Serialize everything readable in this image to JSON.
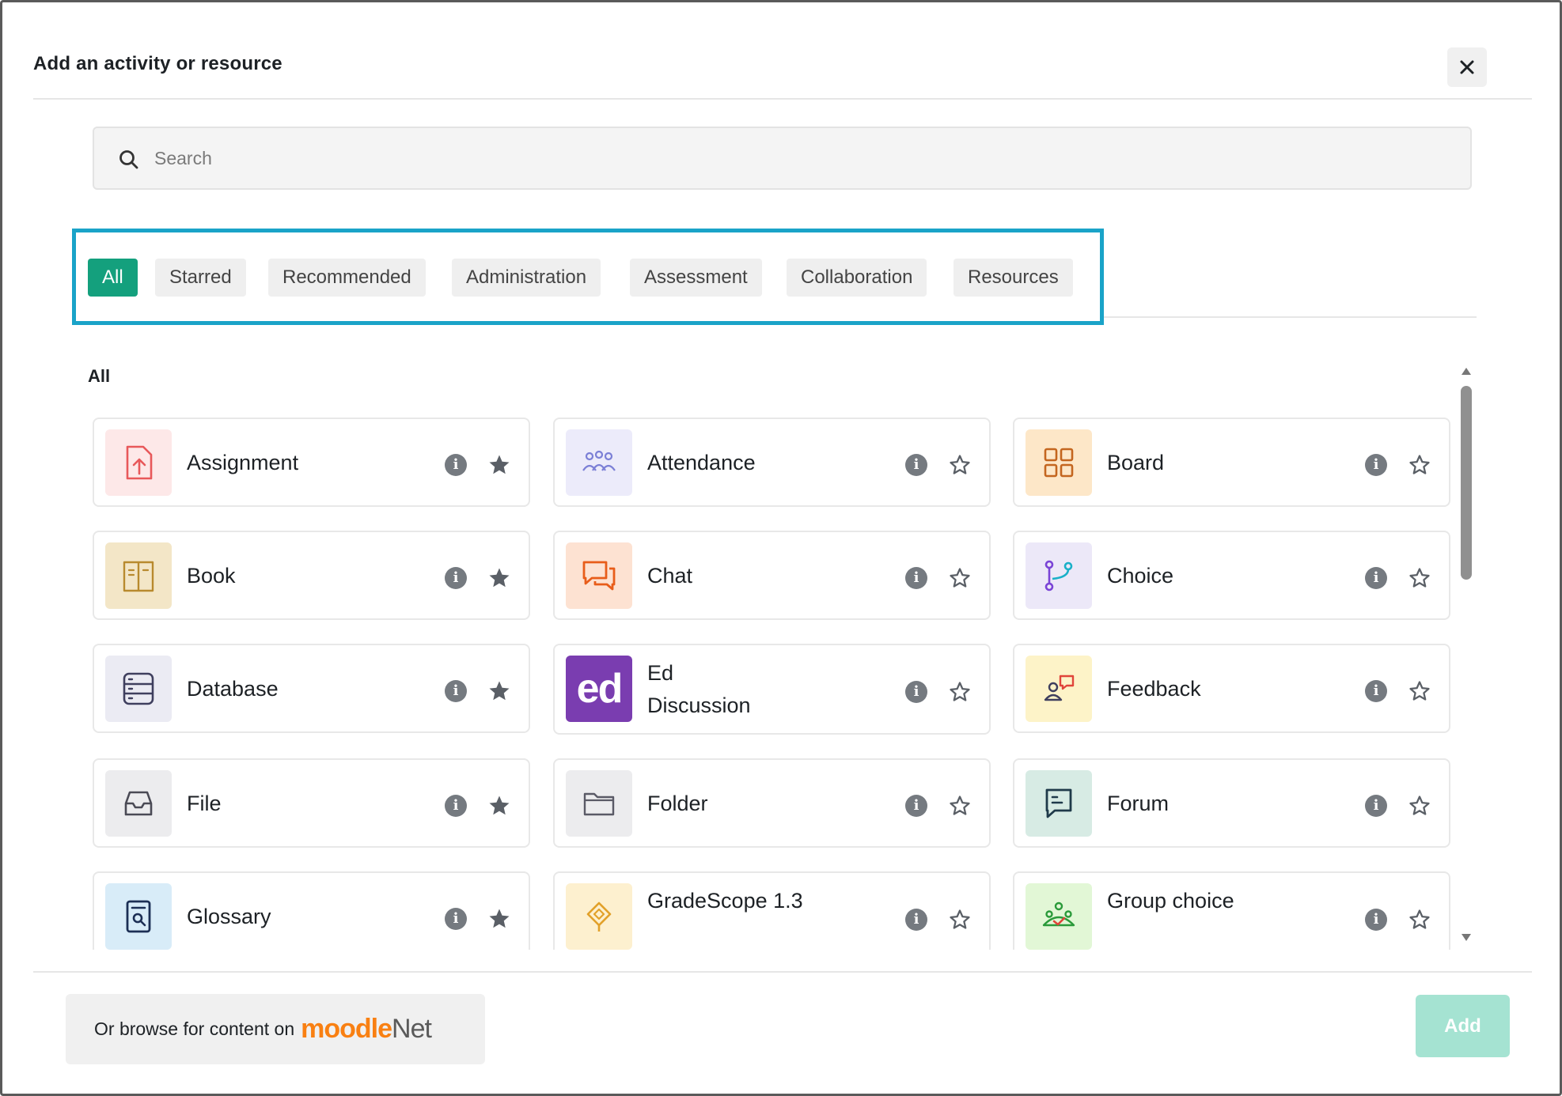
{
  "modal": {
    "title": "Add an activity or resource"
  },
  "search": {
    "placeholder": "Search"
  },
  "tabs": [
    {
      "label": "All",
      "active": true
    },
    {
      "label": "Starred",
      "active": false
    },
    {
      "label": "Recommended",
      "active": false
    },
    {
      "label": "Administration",
      "active": false
    },
    {
      "label": "Assessment",
      "active": false
    },
    {
      "label": "Collaboration",
      "active": false
    },
    {
      "label": "Resources",
      "active": false
    }
  ],
  "section": {
    "heading": "All"
  },
  "activities": [
    {
      "name": "Assignment",
      "icon": "assignment-icon",
      "starred": true
    },
    {
      "name": "Attendance",
      "icon": "attendance-icon",
      "starred": false
    },
    {
      "name": "Board",
      "icon": "board-icon",
      "starred": false
    },
    {
      "name": "Book",
      "icon": "book-icon",
      "starred": true
    },
    {
      "name": "Chat",
      "icon": "chat-icon",
      "starred": false
    },
    {
      "name": "Choice",
      "icon": "choice-icon",
      "starred": false
    },
    {
      "name": "Database",
      "icon": "database-icon",
      "starred": true
    },
    {
      "name": "Ed Discussion",
      "icon": "ed-discussion-icon",
      "icon_text": "ed",
      "starred": false
    },
    {
      "name": "Feedback",
      "icon": "feedback-icon",
      "starred": false
    },
    {
      "name": "File",
      "icon": "file-icon",
      "starred": true
    },
    {
      "name": "Folder",
      "icon": "folder-icon",
      "starred": false
    },
    {
      "name": "Forum",
      "icon": "forum-icon",
      "starred": false
    },
    {
      "name": "Glossary",
      "icon": "glossary-icon",
      "starred": true
    },
    {
      "name": "GradeScope 1.3",
      "icon": "gradescope-icon",
      "starred": false
    },
    {
      "name": "Group choice",
      "icon": "group-choice-icon",
      "starred": false
    }
  ],
  "footer": {
    "browse_text": "Or browse for content on",
    "logo_primary": "moodle",
    "logo_secondary": "Net",
    "add_label": "Add"
  },
  "colors": {
    "accent": "#14a07d",
    "add_disabled": "#a5e3d2",
    "highlight_border": "#1aa3c8"
  }
}
